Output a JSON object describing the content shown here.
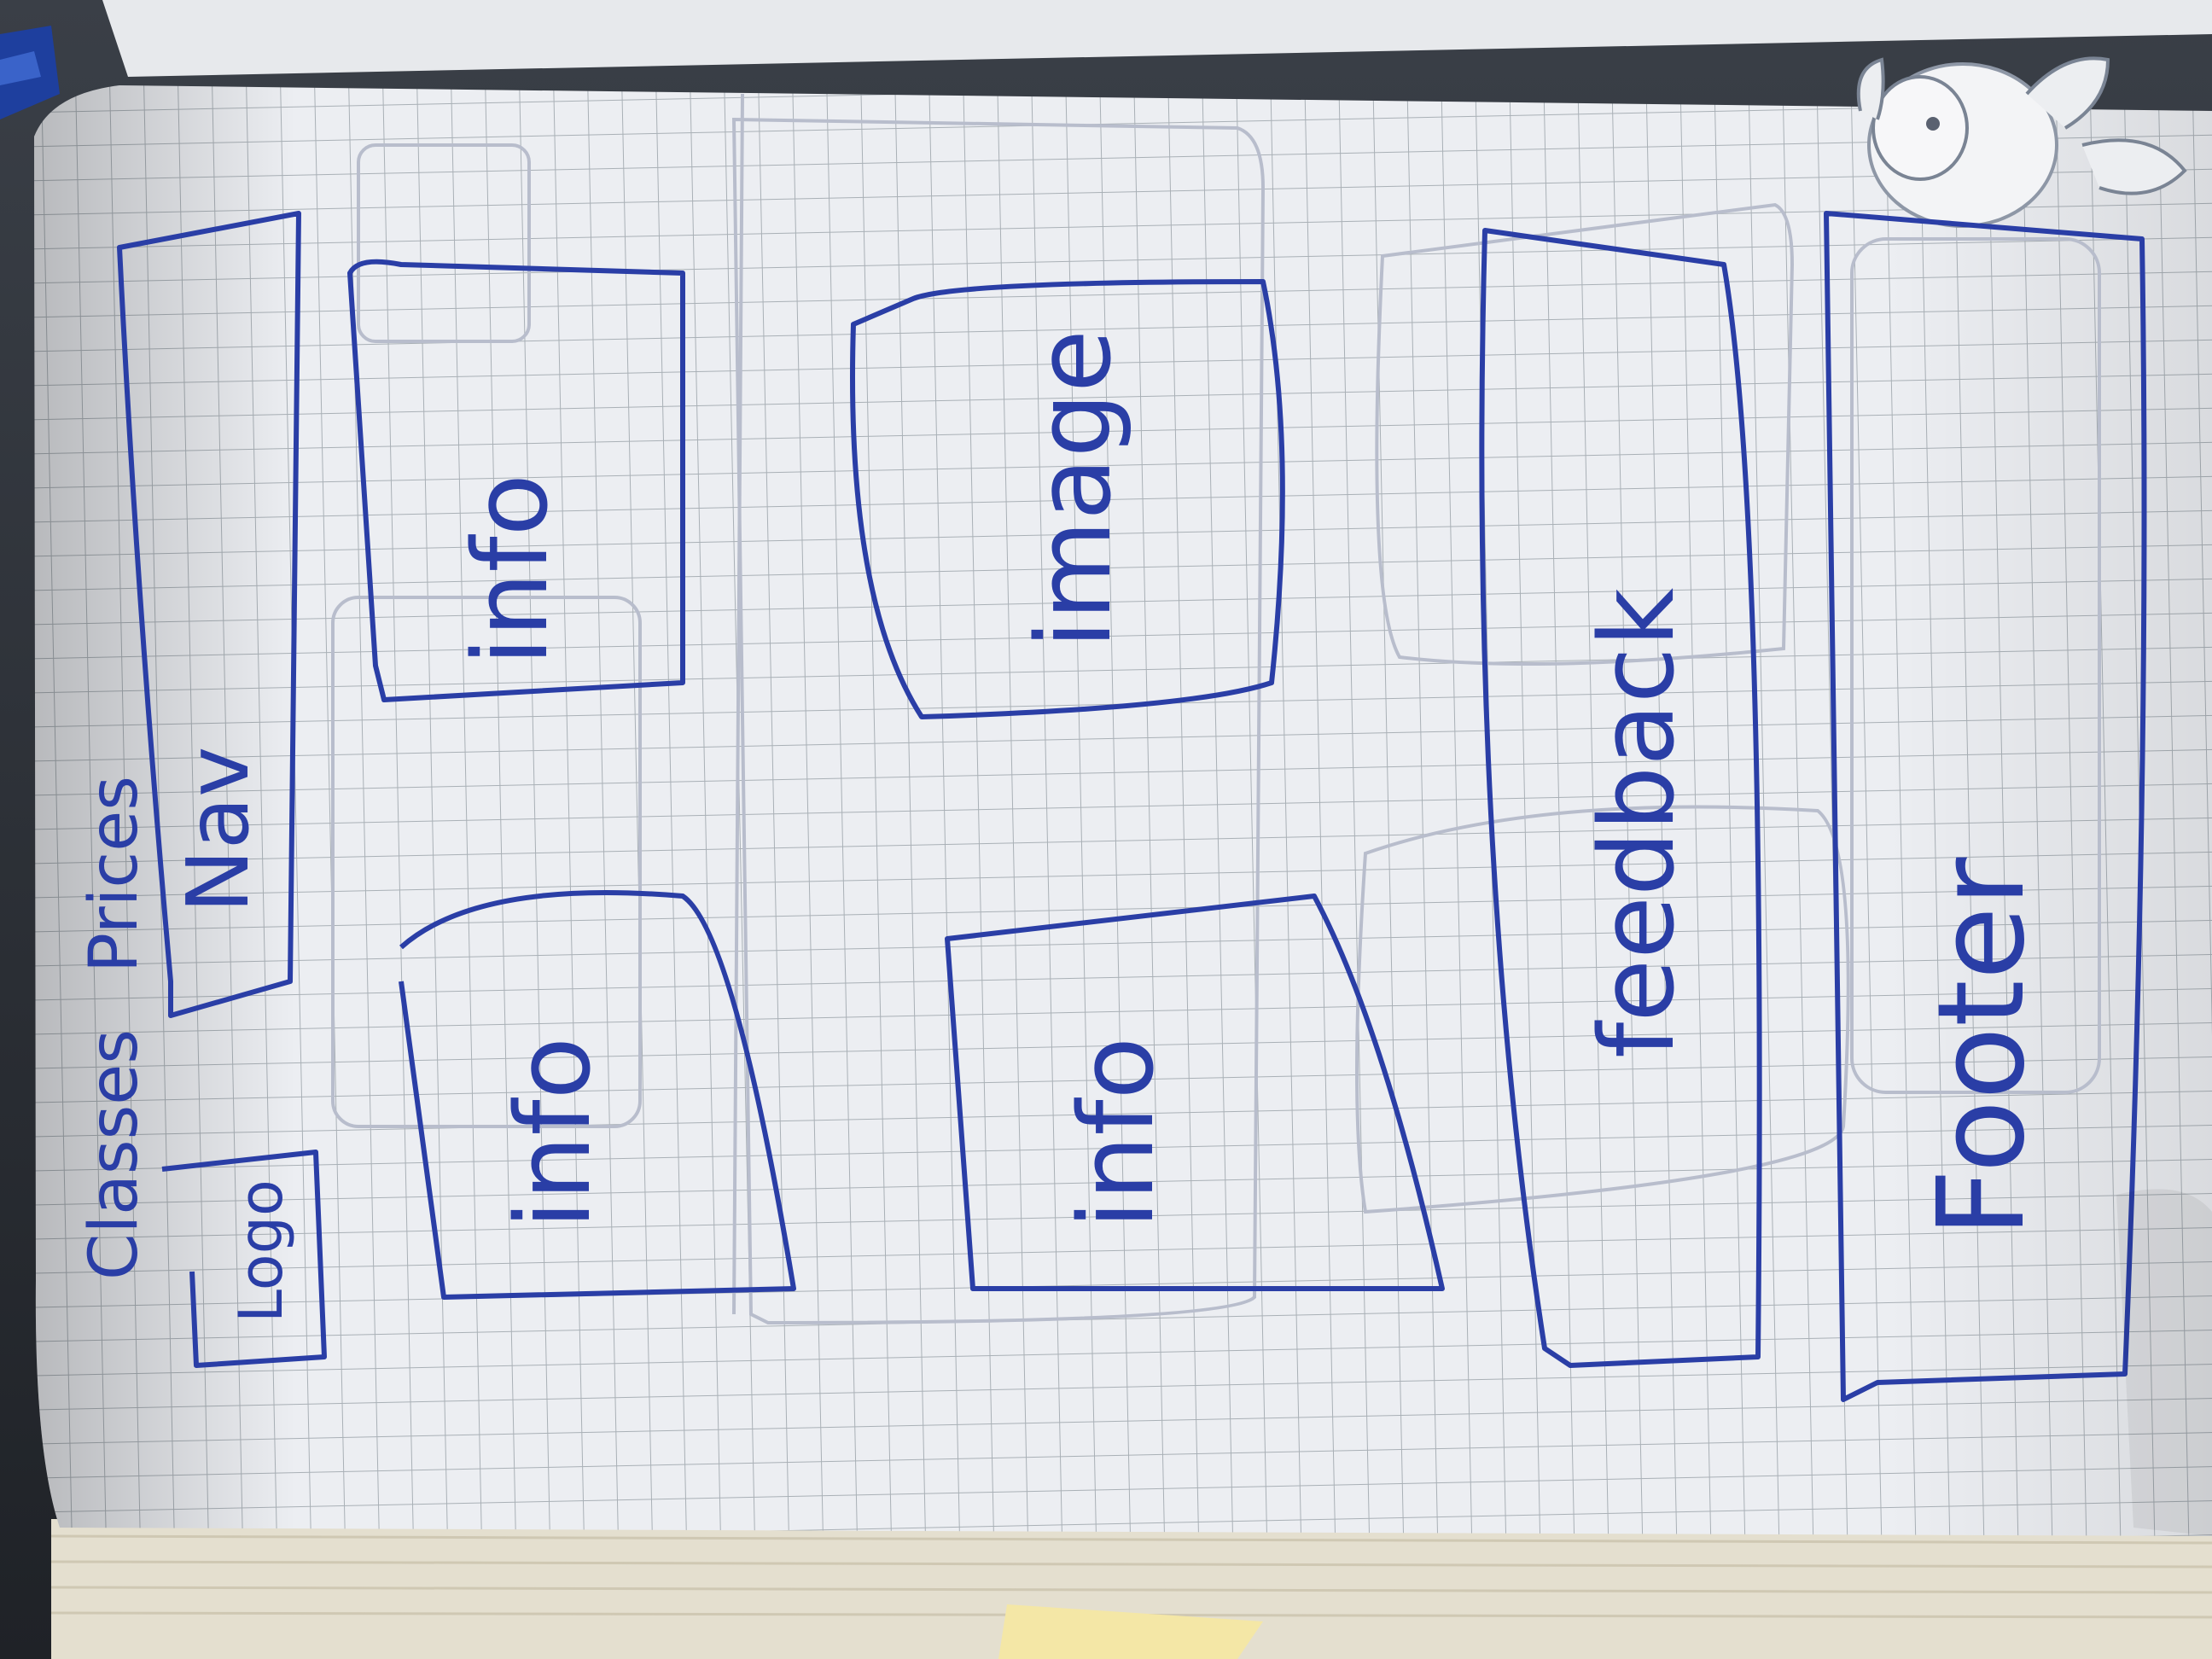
{
  "sketch": {
    "nav_items": [
      "Classes",
      "Prices"
    ],
    "logo_label": "Logo",
    "nav_label": "Nav",
    "info_label_1": "info",
    "info_label_2": "info",
    "info_label_3": "info",
    "image_label": "image",
    "feedback_label": "feedback",
    "footer_label": "Footer"
  },
  "colors": {
    "ink": "#2a3ea6",
    "paper": "#eef0f3",
    "grid": "#a9b0b6",
    "ghost": "#a3a9bf",
    "desk": "#2b2f36"
  }
}
